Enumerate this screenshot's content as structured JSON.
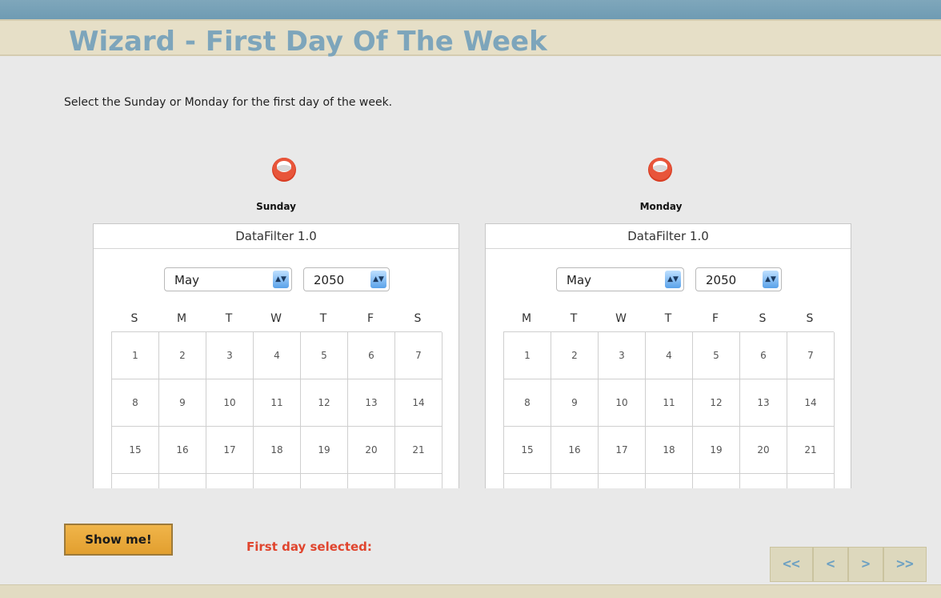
{
  "page": {
    "title": "Wizard - First Day Of The Week",
    "instruction": "Select the Sunday or Monday for the first day of the week."
  },
  "options": [
    {
      "label": "Sunday"
    },
    {
      "label": "Monday"
    }
  ],
  "calendars": [
    {
      "header": "DataFilter 1.0",
      "month": "May",
      "year": "2050",
      "weekdays": [
        "S",
        "M",
        "T",
        "W",
        "T",
        "F",
        "S"
      ],
      "rows": [
        [
          "1",
          "2",
          "3",
          "4",
          "5",
          "6",
          "7"
        ],
        [
          "8",
          "9",
          "10",
          "11",
          "12",
          "13",
          "14"
        ],
        [
          "15",
          "16",
          "17",
          "18",
          "19",
          "20",
          "21"
        ],
        [
          "",
          "",
          "",
          "",
          "",
          "",
          ""
        ]
      ]
    },
    {
      "header": "DataFilter 1.0",
      "month": "May",
      "year": "2050",
      "weekdays": [
        "M",
        "T",
        "W",
        "T",
        "F",
        "S",
        "S"
      ],
      "rows": [
        [
          "1",
          "2",
          "3",
          "4",
          "5",
          "6",
          "7"
        ],
        [
          "8",
          "9",
          "10",
          "11",
          "12",
          "13",
          "14"
        ],
        [
          "15",
          "16",
          "17",
          "18",
          "19",
          "20",
          "21"
        ],
        [
          "",
          "",
          "",
          "",
          "",
          "",
          ""
        ]
      ]
    }
  ],
  "actions": {
    "show_me": "Show me!",
    "first_day_selected": "First day selected:"
  },
  "nav": {
    "first": "<<",
    "prev": "<",
    "next": ">",
    "last": ">>"
  },
  "colors": {
    "title": "#7da5bb",
    "accent_button": "#e8a83a",
    "status_text": "#e0452e",
    "radio": "#e04a2c"
  }
}
